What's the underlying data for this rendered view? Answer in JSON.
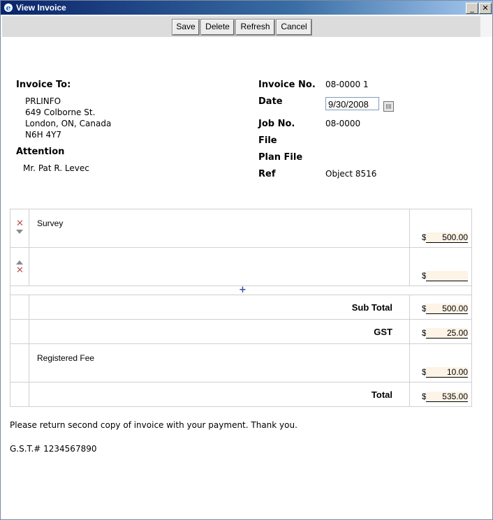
{
  "window": {
    "title": "View Invoice",
    "minimize_glyph": "_",
    "close_glyph": "✕",
    "icon": "ie-icon"
  },
  "toolbar": {
    "save": "Save",
    "delete": "Delete",
    "refresh": "Refresh",
    "cancel": "Cancel"
  },
  "invoice_to": {
    "label": "Invoice To:",
    "lines": [
      "PRLINFO",
      "649 Colborne St.",
      "London, ON, Canada",
      "N6H 4Y7"
    ]
  },
  "attention": {
    "label": "Attention",
    "value": "Mr. Pat R. Levec"
  },
  "details": {
    "invoice_no_label": "Invoice No.",
    "invoice_no": "08-0000 1",
    "date_label": "Date",
    "date": "9/30/2008",
    "job_no_label": "Job No.",
    "job_no": "08-0000",
    "file_label": "File",
    "plan_file_label": "Plan File",
    "ref_label": "Ref",
    "ref": "Object 8516"
  },
  "currency_symbol": "$",
  "line_items": [
    {
      "description": "Survey",
      "amount": "500.00"
    },
    {
      "description": "",
      "amount": ""
    }
  ],
  "add_glyph": "+",
  "remove_glyph": "✕",
  "totals": {
    "subtotal_label": "Sub Total",
    "subtotal": "500.00",
    "gst_label": "GST",
    "gst": "25.00",
    "fee_label": "Registered Fee",
    "fee": "10.00",
    "total_label": "Total",
    "total": "535.00"
  },
  "footer": {
    "note": "Please return second copy of invoice with your payment. Thank you.",
    "gst_number": "G.S.T.# 1234567890"
  }
}
